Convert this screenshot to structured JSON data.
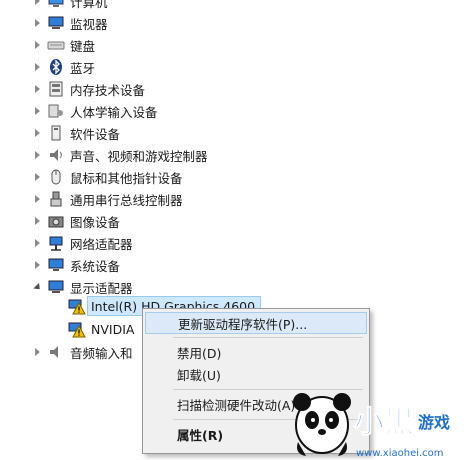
{
  "tree": [
    {
      "label": "计算机",
      "icon": "computer-icon",
      "expanded": false
    },
    {
      "label": "监视器",
      "icon": "monitor-icon",
      "expanded": false
    },
    {
      "label": "键盘",
      "icon": "keyboard-icon",
      "expanded": false
    },
    {
      "label": "蓝牙",
      "icon": "bluetooth-icon",
      "expanded": false
    },
    {
      "label": "内存技术设备",
      "icon": "memory-icon",
      "expanded": false
    },
    {
      "label": "人体学输入设备",
      "icon": "hid-icon",
      "expanded": false
    },
    {
      "label": "软件设备",
      "icon": "software-device-icon",
      "expanded": false
    },
    {
      "label": "声音、视频和游戏控制器",
      "icon": "sound-icon",
      "expanded": false
    },
    {
      "label": "鼠标和其他指针设备",
      "icon": "mouse-icon",
      "expanded": false
    },
    {
      "label": "通用串行总线控制器",
      "icon": "usb-icon",
      "expanded": false
    },
    {
      "label": "图像设备",
      "icon": "camera-icon",
      "expanded": false
    },
    {
      "label": "网络适配器",
      "icon": "network-icon",
      "expanded": false
    },
    {
      "label": "系统设备",
      "icon": "system-device-icon",
      "expanded": false
    },
    {
      "label": "显示适配器",
      "icon": "display-adapter-icon",
      "expanded": true
    },
    {
      "label": "音频输入和",
      "icon": "audio-icon",
      "expanded": false
    }
  ],
  "display_children": [
    {
      "label": "Intel(R) HD Graphics 4600",
      "icon": "warning-icon"
    },
    {
      "label": "NVIDIA",
      "icon": "warning-icon"
    }
  ],
  "context_menu": [
    {
      "label": "更新驱动程序软件(P)...",
      "highlighted": true,
      "bold": false
    },
    {
      "label": "禁用(D)",
      "highlighted": false,
      "bold": false
    },
    {
      "label": "卸载(U)",
      "highlighted": false,
      "bold": false
    },
    {
      "label": "扫描检测硬件改动(A)",
      "highlighted": false,
      "bold": false
    },
    {
      "label": "属性(R)",
      "highlighted": false,
      "bold": true
    }
  ],
  "watermark": {
    "url": "www.xiaohei.com",
    "brand": "小黑",
    "sub": "游戏"
  },
  "colors": {
    "selection": "#cde8ff",
    "menu_bg": "#f0f0f0",
    "menu_highlight": "#dbe9f8",
    "watermark_blue": "#1e6fd0"
  }
}
